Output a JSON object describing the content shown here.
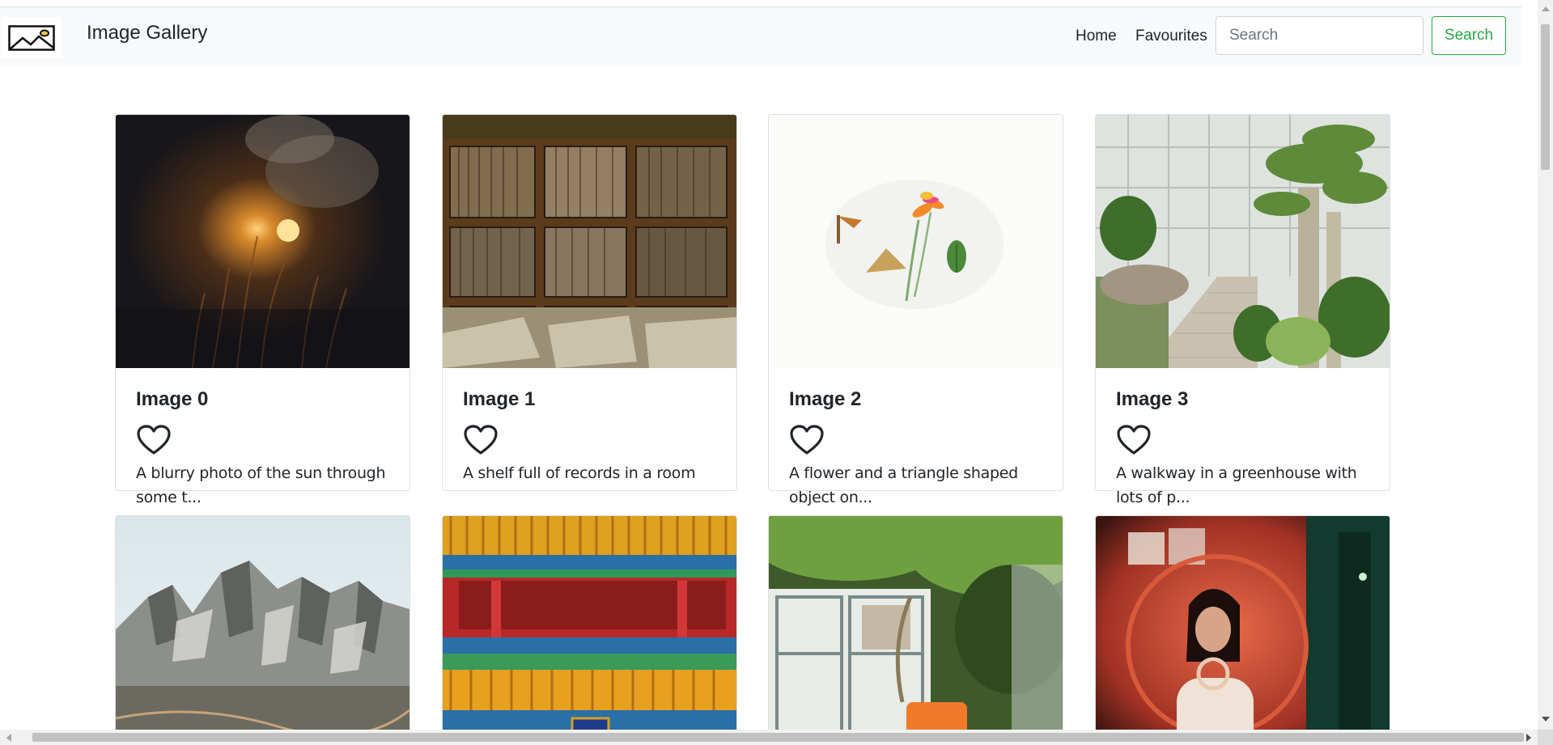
{
  "navbar": {
    "brand": "Image Gallery",
    "logo_icon": "image-icon",
    "links": [
      "Home",
      "Favourites"
    ],
    "search_placeholder": "Search",
    "search_button": "Search",
    "accent_color": "#28a745"
  },
  "cards": [
    {
      "title": "Image 0",
      "description": "A blurry photo of the sun through some t...",
      "favourite": false
    },
    {
      "title": "Image 1",
      "description": "A shelf full of records in a room",
      "favourite": false
    },
    {
      "title": "Image 2",
      "description": "A flower and a triangle shaped object on...",
      "favourite": false
    },
    {
      "title": "Image 3",
      "description": "A walkway in a greenhouse with lots of p...",
      "favourite": false
    },
    {
      "title": "",
      "description": "",
      "favourite": false
    },
    {
      "title": "",
      "description": "",
      "favourite": false
    },
    {
      "title": "",
      "description": "",
      "favourite": false
    },
    {
      "title": "",
      "description": "",
      "favourite": false
    }
  ]
}
